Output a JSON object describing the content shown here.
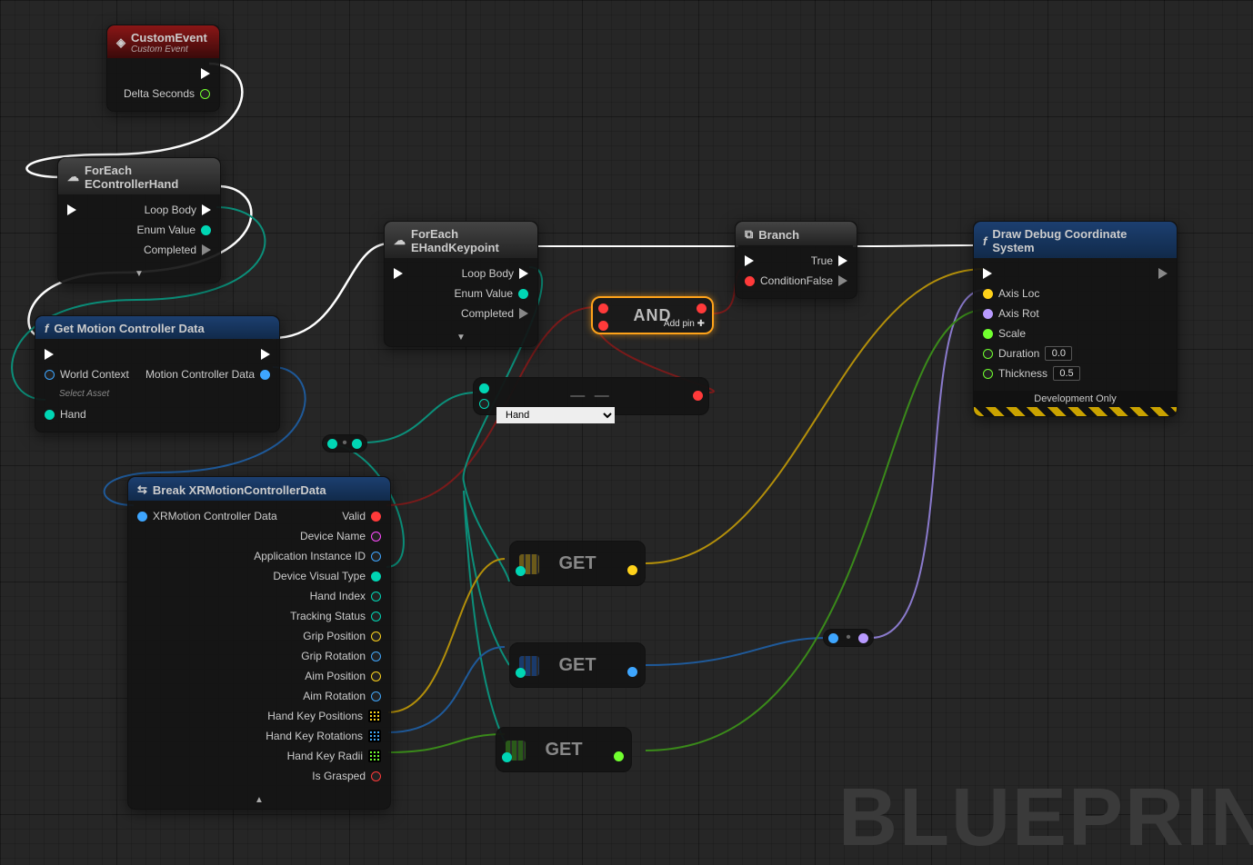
{
  "watermark": "BLUEPRIN",
  "nodes": {
    "customEvent": {
      "title": "CustomEvent",
      "subtitle": "Custom Event",
      "outputs": {
        "exec": "",
        "delta": "Delta Seconds"
      }
    },
    "foreachHand": {
      "title": "ForEach EControllerHand",
      "outputs": {
        "loopBody": "Loop Body",
        "enumValue": "Enum Value",
        "completed": "Completed"
      }
    },
    "getMotion": {
      "title": "Get Motion Controller Data",
      "inputs": {
        "worldContext": "World Context",
        "assetHint": "Select Asset",
        "hand": "Hand"
      },
      "outputs": {
        "data": "Motion Controller Data"
      }
    },
    "foreachKeypoint": {
      "title": "ForEach EHandKeypoint",
      "outputs": {
        "loopBody": "Loop Body",
        "enumValue": "Enum Value",
        "completed": "Completed"
      }
    },
    "and": {
      "title": "AND",
      "addPin": "Add pin ✚"
    },
    "equal": {
      "selectValue": "Hand"
    },
    "branch": {
      "title": "Branch",
      "inputs": {
        "condition": "Condition"
      },
      "outputs": {
        "true": "True",
        "false": "False"
      }
    },
    "drawDebug": {
      "title": "Draw Debug Coordinate System",
      "pins": {
        "axisLoc": "Axis Loc",
        "axisRot": "Axis Rot",
        "scale": "Scale",
        "duration": "Duration",
        "thickness": "Thickness"
      },
      "values": {
        "duration": "0.0",
        "thickness": "0.5"
      },
      "footer": "Development Only"
    },
    "breakXR": {
      "title": "Break XRMotionControllerData",
      "input": "XRMotion Controller Data",
      "outputs": {
        "valid": "Valid",
        "deviceName": "Device Name",
        "appId": "Application Instance ID",
        "visualType": "Device Visual Type",
        "handIndex": "Hand Index",
        "tracking": "Tracking Status",
        "gripPos": "Grip Position",
        "gripRot": "Grip Rotation",
        "aimPos": "Aim Position",
        "aimRot": "Aim Rotation",
        "keyPos": "Hand Key Positions",
        "keyRot": "Hand Key Rotations",
        "keyRadii": "Hand Key Radii",
        "grasped": "Is Grasped"
      }
    },
    "get": {
      "label": "GET"
    }
  }
}
